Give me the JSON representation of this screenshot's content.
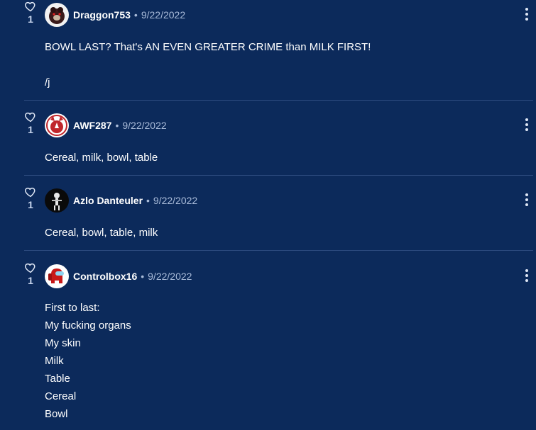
{
  "comments": [
    {
      "likes": "1",
      "username": "Draggon753",
      "date": "9/22/2022",
      "lines": [
        "BOWL LAST? That's AN EVEN GREATER CRIME than MILK FIRST!",
        "",
        "/j"
      ]
    },
    {
      "likes": "1",
      "username": "AWF287",
      "date": "9/22/2022",
      "lines": [
        "Cereal, milk, bowl, table"
      ]
    },
    {
      "likes": "1",
      "username": "Azlo Danteuler",
      "date": "9/22/2022",
      "lines": [
        "Cereal, bowl, table, milk"
      ]
    },
    {
      "likes": "1",
      "username": "Controlbox16",
      "date": "9/22/2022",
      "lines": [
        "First to last:",
        "My fucking organs",
        "My skin",
        "Milk",
        "Table",
        "Cereal",
        "Bowl"
      ]
    }
  ],
  "separator": "•",
  "icons": {
    "like": "heart-outline-icon",
    "menu": "kebab-menu-icon"
  },
  "colors": {
    "background": "#0c2a5b",
    "divider": "#2e4c80",
    "muted_text": "#a9bbd9"
  }
}
